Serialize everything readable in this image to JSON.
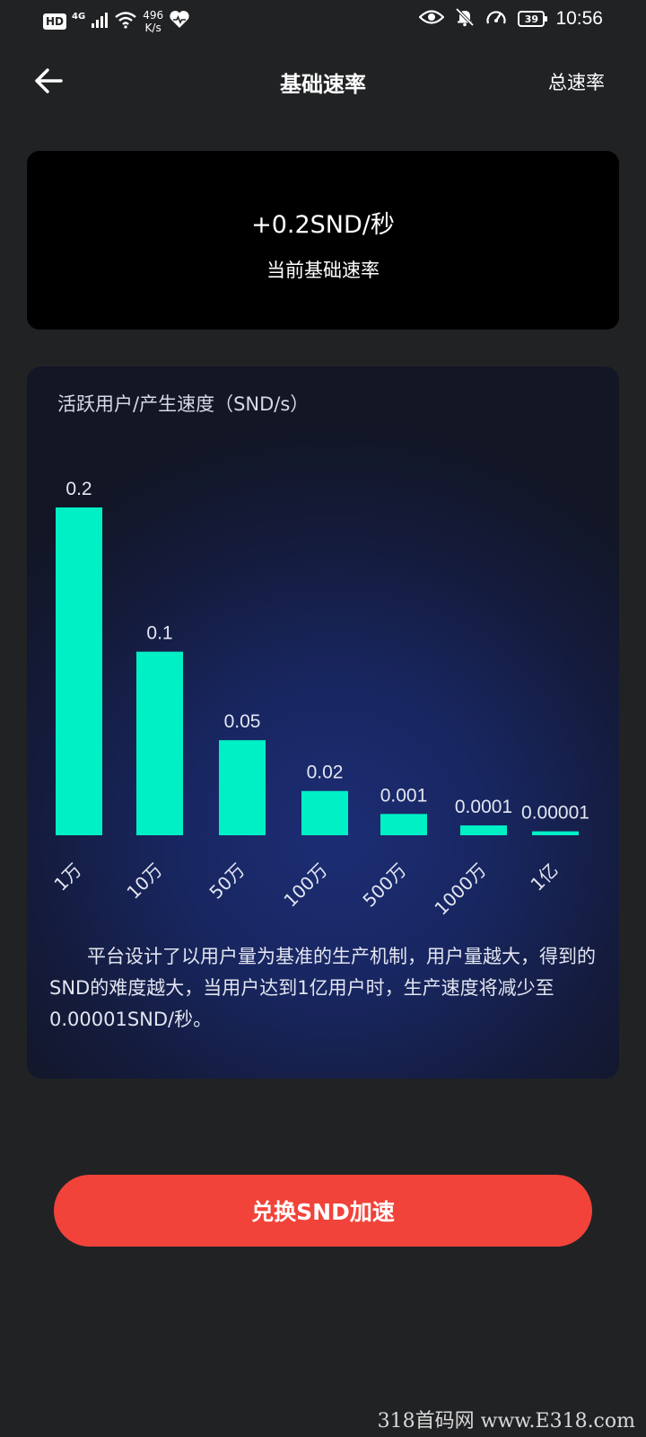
{
  "status_bar": {
    "hd": "HD",
    "network": "4G",
    "speed_value": "496",
    "speed_unit": "K/s",
    "battery": "39",
    "time": "10:56"
  },
  "header": {
    "title": "基础速率",
    "total_rate_label": "总速率"
  },
  "rate_card": {
    "value": "+0.2SND/秒",
    "caption": "当前基础速率"
  },
  "chart_card": {
    "title": "活跃用户/产生速度（SND/s）",
    "description": "平台设计了以用户量为基准的生产机制，用户量越大，得到的SND的难度越大，当用户达到1亿用户时，生产速度将减少至0.00001SND/秒。"
  },
  "chart_data": {
    "type": "bar",
    "title": "活跃用户/产生速度（SND/s）",
    "categories": [
      "1万",
      "10万",
      "50万",
      "100万",
      "500万",
      "1000万",
      "1亿"
    ],
    "values": [
      0.2,
      0.1,
      0.05,
      0.02,
      0.001,
      0.0001,
      1e-05
    ],
    "value_labels": [
      "0.2",
      "0.1",
      "0.05",
      "0.02",
      "0.001",
      "0.0001",
      "0.00001"
    ],
    "bar_color": "#00f0c6",
    "grid": false,
    "legend": "none"
  },
  "button": {
    "label": "兑换SND加速"
  },
  "watermark": "318首码网  www.E318.com",
  "colors": {
    "background": "#212224",
    "accent": "#f1433a",
    "bar": "#00f0c6"
  }
}
